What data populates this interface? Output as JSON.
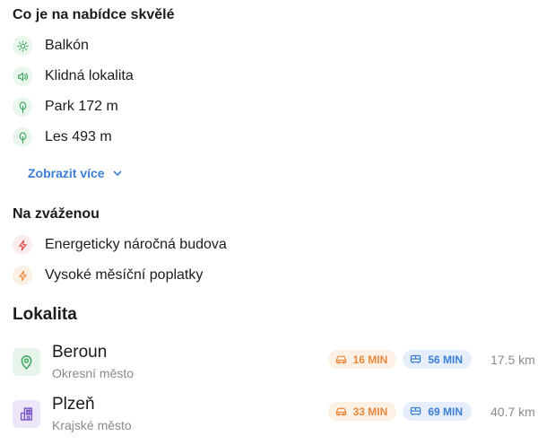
{
  "highlights": {
    "title": "Co je na nabídce skvělé",
    "items": [
      {
        "icon": "sun-icon",
        "label": "Balkón"
      },
      {
        "icon": "sound-icon",
        "label": "Klidná lokalita"
      },
      {
        "icon": "tree-icon",
        "label": "Park 172 m"
      },
      {
        "icon": "tree-icon",
        "label": "Les 493 m"
      }
    ],
    "show_more_label": "Zobrazit více"
  },
  "considerations": {
    "title": "Na zváženou",
    "items": [
      {
        "icon": "lightning-icon",
        "label": "Energeticky náročná budova",
        "color": "#e04646"
      },
      {
        "icon": "lightning-icon",
        "label": "Vysoké měsíční poplatky",
        "color": "#ef8a3c"
      }
    ]
  },
  "location": {
    "title": "Lokalita",
    "places": [
      {
        "icon": "map-pin-icon",
        "name": "Beroun",
        "type": "Okresní město",
        "car_time": "16 MIN",
        "bus_time": "56 MIN",
        "distance": "17.5 km"
      },
      {
        "icon": "building-icon",
        "name": "Plzeň",
        "type": "Krajské město",
        "car_time": "33 MIN",
        "bus_time": "69 MIN",
        "distance": "40.7 km"
      }
    ]
  },
  "colors": {
    "accent_blue": "#3a7fd5",
    "green": "#3aa55d",
    "red": "#e04646",
    "orange": "#ef8a3c",
    "purple": "#7a5bc7"
  }
}
